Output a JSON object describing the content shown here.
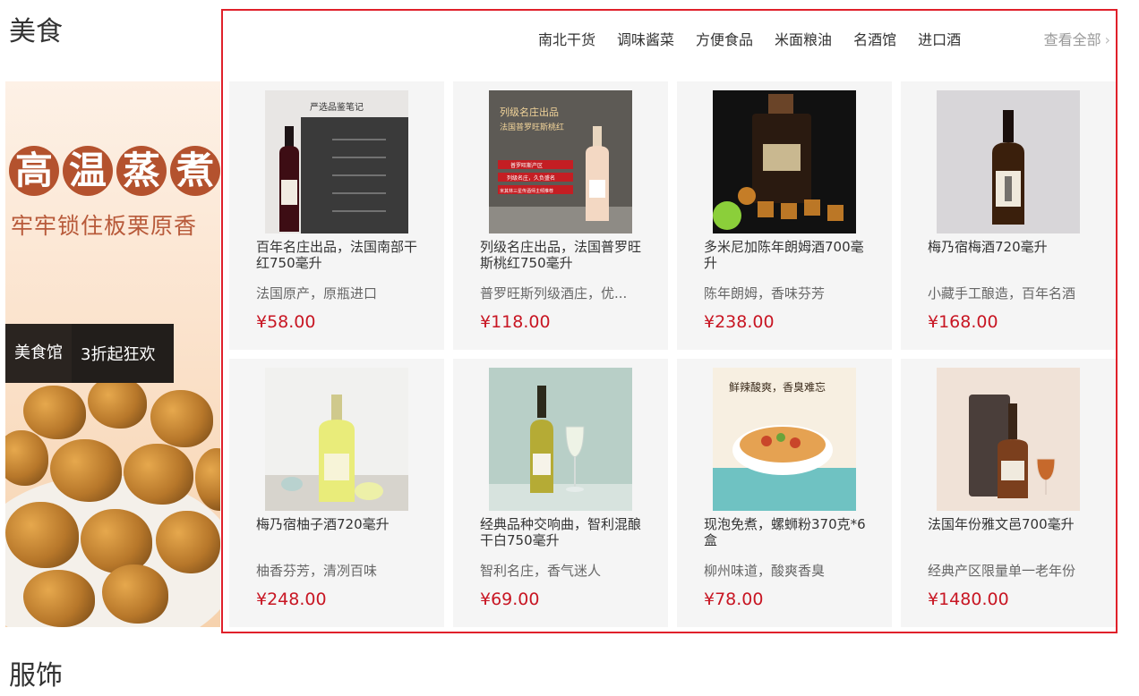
{
  "section": {
    "title": "美食",
    "next_title": "服饰"
  },
  "promo": {
    "headline_chars": [
      "高",
      "温",
      "蒸",
      "煮"
    ],
    "subline": "牢牢锁住板栗原香",
    "band_left": "美食馆",
    "band_right": "3折起狂欢"
  },
  "tabs": [
    "南北干货",
    "调味酱菜",
    "方便食品",
    "米面粮油",
    "名酒馆",
    "进口酒"
  ],
  "view_all": "查看全部",
  "products": [
    {
      "name": "百年名庄出品，法国南部干红750毫升",
      "desc": "法国原产，原瓶进口",
      "price": "¥58.00",
      "image_text": [
        "严选品鉴笔记"
      ]
    },
    {
      "name": "列级名庄出品，法国普罗旺斯桃红750毫升",
      "desc": "普罗旺斯列级酒庄，优...",
      "price": "¥118.00",
      "image_text": [
        "列级名庄出品",
        "法国普罗旺斯桃红",
        "普罗旺斯产区",
        "列级名庄，久负盛名",
        "米其林三星传酒师主倾推荐"
      ]
    },
    {
      "name": "多米尼加陈年朗姆酒700毫升",
      "desc": "陈年朗姆，香味芬芳",
      "price": "¥238.00",
      "image_text": []
    },
    {
      "name": "梅乃宿梅酒720毫升",
      "desc": "小藏手工酿造，百年名酒",
      "price": "¥168.00",
      "image_text": []
    },
    {
      "name": "梅乃宿柚子酒720毫升",
      "desc": "柚香芬芳，清冽百味",
      "price": "¥248.00",
      "image_text": []
    },
    {
      "name": "经典品种交响曲，智利混酿干白750毫升",
      "desc": "智利名庄，香气迷人",
      "price": "¥69.00",
      "image_text": []
    },
    {
      "name": "现泡免煮，螺蛳粉370克*6盒",
      "desc": "柳州味道，酸爽香臭",
      "price": "¥78.00",
      "image_text": [
        "鲜辣酸爽，香臭难忘"
      ]
    },
    {
      "name": "法国年份雅文邑700毫升",
      "desc": "经典产区限量单一老年份",
      "price": "¥1480.00",
      "image_text": []
    }
  ]
}
